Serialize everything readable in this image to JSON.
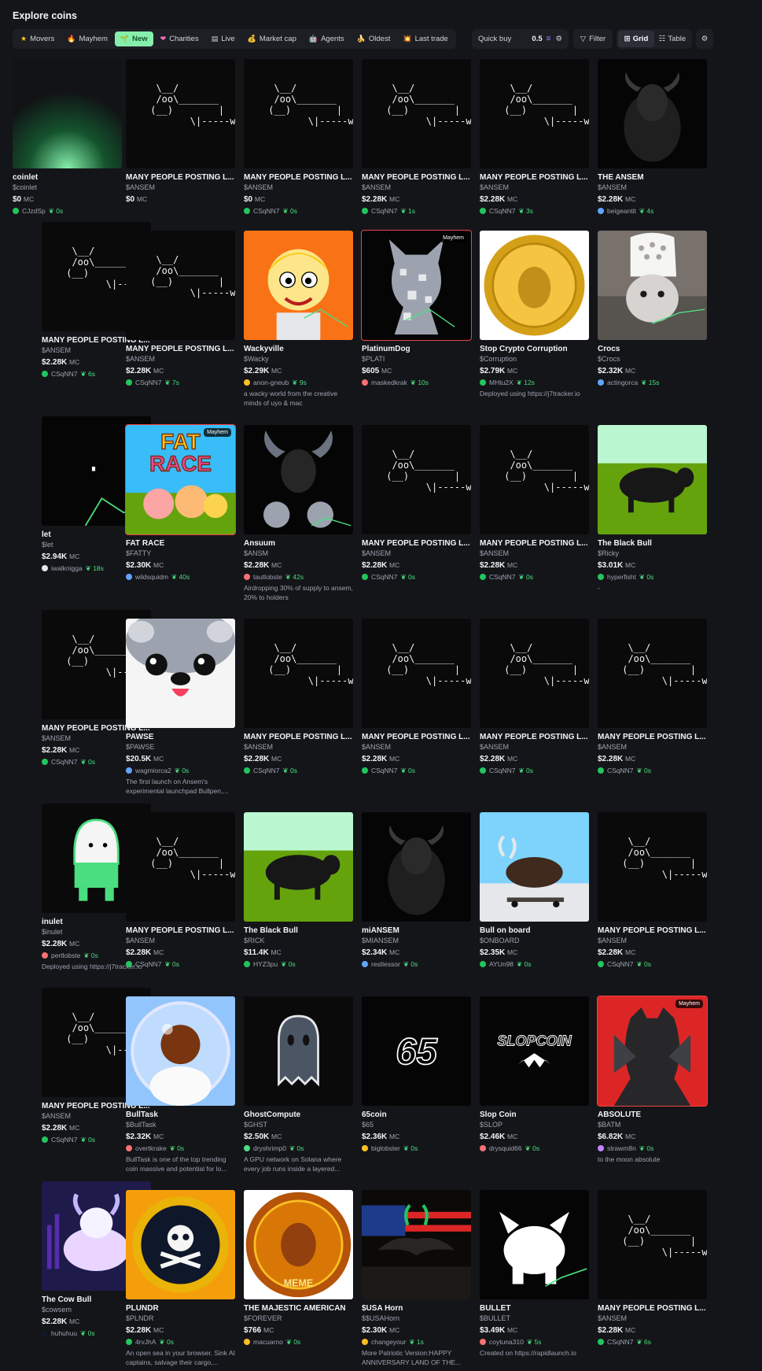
{
  "page_title": "Explore coins",
  "filters": [
    {
      "label": "Movers",
      "icon": "star-icon",
      "glyph": "★",
      "color": "#facc15"
    },
    {
      "label": "Mayhem",
      "icon": "fire-icon",
      "glyph": "🔥",
      "color": "#f97316"
    },
    {
      "label": "New",
      "icon": "sprout-icon",
      "glyph": "🌱",
      "color": "#14532d",
      "active": true
    },
    {
      "label": "Charities",
      "icon": "heart-icon",
      "glyph": "❤",
      "color": "#f472b6"
    },
    {
      "label": "Live",
      "icon": "film-icon",
      "glyph": "▤",
      "color": "#d1d5db"
    },
    {
      "label": "Market cap",
      "icon": "money-bag-icon",
      "glyph": "💰",
      "color": "#facc15"
    },
    {
      "label": "Agents",
      "icon": "robot-icon",
      "glyph": "🤖",
      "color": "#d1d5db"
    },
    {
      "label": "Oldest",
      "icon": "banana-icon",
      "glyph": "🍌",
      "color": "#facc15"
    },
    {
      "label": "Last trade",
      "icon": "sparkle-icon",
      "glyph": "💥",
      "color": "#f97316"
    }
  ],
  "quick_buy": {
    "label": "Quick buy",
    "value": "0.5"
  },
  "filter_label": "Filter",
  "view": {
    "grid": "Grid",
    "table": "Table"
  },
  "mc_unit": "MC",
  "cards": [
    {
      "name": "coinlet",
      "ticker": "$coinlet",
      "mc": "$0",
      "user": "CJzdSp",
      "age": "0s",
      "img": "glow"
    },
    {
      "name": "MANY PEOPLE POSTING L...",
      "ticker": "$ANSEM",
      "mc": "$0",
      "user": "",
      "age": "",
      "img": "ascii"
    },
    {
      "name": "MANY PEOPLE POSTING L...",
      "ticker": "$ANSEM",
      "mc": "$0",
      "user": "CSqNN7",
      "age": "0s",
      "img": "ascii"
    },
    {
      "name": "MANY PEOPLE POSTING L...",
      "ticker": "$ANSEM",
      "mc": "$2.28K",
      "user": "CSqNN7",
      "age": "1s",
      "img": "ascii"
    },
    {
      "name": "MANY PEOPLE POSTING L...",
      "ticker": "$ANSEM",
      "mc": "$2.28K",
      "user": "CSqNN7",
      "age": "3s",
      "img": "ascii"
    },
    {
      "name": "THE ANSEM",
      "ticker": "$ANSEM",
      "mc": "$2.28K",
      "user": "beigeantit",
      "age": "4s",
      "img": "bulldark",
      "av": "#60a5fa"
    },
    {
      "name": "MANY PEOPLE POSTING L...",
      "ticker": "$ANSEM",
      "mc": "$2.28K",
      "user": "CSqNN7",
      "age": "6s",
      "img": "ascii"
    },
    {
      "name": "MANY PEOPLE POSTING L...",
      "ticker": "$ANSEM",
      "mc": "$2.28K",
      "user": "CSqNN7",
      "age": "7s",
      "img": "ascii"
    },
    {
      "name": "Wackyville",
      "ticker": "$Wacky",
      "mc": "$2.29K",
      "user": "anon-gneub",
      "age": "9s",
      "img": "cartoon",
      "av": "#fbbf24",
      "desc": "a wacky world from the creative minds of uyo & mac"
    },
    {
      "name": "PlatinumDog",
      "ticker": "$PLATI",
      "mc": "$605",
      "user": "maskedkrak",
      "age": "10s",
      "img": "dog",
      "badge": "Mayhem",
      "border": "red",
      "av": "#f87171"
    },
    {
      "name": "Stop Crypto Corruption",
      "ticker": "$Corruption",
      "mc": "$2.79K",
      "user": "MHtu2X",
      "age": "12s",
      "img": "coin",
      "desc": "Deployed using https://j7tracker.io"
    },
    {
      "name": "Crocs",
      "ticker": "$Crocs",
      "mc": "$2.32K",
      "user": "actingorca",
      "age": "15s",
      "img": "cat",
      "av": "#60a5fa"
    },
    {
      "name": "let",
      "ticker": "$let",
      "mc": "$2.94K",
      "user": "iwalknigga",
      "age": "18s",
      "img": "dot",
      "av": "#e5e7eb"
    },
    {
      "name": "FAT RACE",
      "ticker": "$FATTY",
      "mc": "$2.30K",
      "user": "wildsquidm",
      "age": "40s",
      "img": "fatrace",
      "badge": "Mayhem",
      "border": "red",
      "av": "#60a5fa"
    },
    {
      "name": "Ansuum",
      "ticker": "$ANSM",
      "mc": "$2.28K",
      "user": "tautlobste",
      "age": "42s",
      "img": "ansuum",
      "av": "#f87171",
      "desc": "Airdropping 30% of supply to ansem, 20% to holders"
    },
    {
      "name": "MANY PEOPLE POSTING L...",
      "ticker": "$ANSEM",
      "mc": "$2.28K",
      "user": "CSqNN7",
      "age": "0s",
      "img": "ascii"
    },
    {
      "name": "MANY PEOPLE POSTING L...",
      "ticker": "$ANSEM",
      "mc": "$2.28K",
      "user": "CSqNN7",
      "age": "0s",
      "img": "ascii"
    },
    {
      "name": "The Black Bull",
      "ticker": "$Ricky",
      "mc": "$3.01K",
      "user": "hyperfisht",
      "age": "0s",
      "img": "bullfield",
      "desc": "-"
    },
    {
      "name": "MANY PEOPLE POSTING L...",
      "ticker": "$ANSEM",
      "mc": "$2.28K",
      "user": "CSqNN7",
      "age": "0s",
      "img": "ascii"
    },
    {
      "name": "PAWSE",
      "ticker": "$PAWSE",
      "mc": "$20.5K",
      "user": "wagmiorca2",
      "age": "0s",
      "img": "pawse",
      "av": "#60a5fa",
      "desc": "The first launch on Ansem's experimental launchpad Bullpen,..."
    },
    {
      "name": "MANY PEOPLE POSTING L...",
      "ticker": "$ANSEM",
      "mc": "$2.28K",
      "user": "CSqNN7",
      "age": "0s",
      "img": "ascii"
    },
    {
      "name": "MANY PEOPLE POSTING L...",
      "ticker": "$ANSEM",
      "mc": "$2.28K",
      "user": "CSqNN7",
      "age": "0s",
      "img": "ascii"
    },
    {
      "name": "MANY PEOPLE POSTING L...",
      "ticker": "$ANSEM",
      "mc": "$2.28K",
      "user": "CSqNN7",
      "age": "0s",
      "img": "ascii"
    },
    {
      "name": "MANY PEOPLE POSTING L...",
      "ticker": "$ANSEM",
      "mc": "$2.28K",
      "user": "CSqNN7",
      "age": "0s",
      "img": "ascii"
    },
    {
      "name": "inulet",
      "ticker": "$inulet",
      "mc": "$2.28K",
      "user": "pertlobste",
      "age": "0s",
      "img": "ghostgreen",
      "av": "#f87171",
      "desc": "Deployed using https://j7tracker.io"
    },
    {
      "name": "MANY PEOPLE POSTING L...",
      "ticker": "$ANSEM",
      "mc": "$2.28K",
      "user": "CSqNN7",
      "age": "0s",
      "img": "ascii"
    },
    {
      "name": "The Black Bull",
      "ticker": "$RICK",
      "mc": "$11.4K",
      "user": "HYZ3pu",
      "age": "0s",
      "img": "bullfield"
    },
    {
      "name": "miANSEM",
      "ticker": "$MIANSEM",
      "mc": "$2.34K",
      "user": "restlessor",
      "age": "0s",
      "img": "bulldark",
      "av": "#60a5fa"
    },
    {
      "name": "Bull on board",
      "ticker": "$ONBOARD",
      "mc": "$2.35K",
      "user": "AYUn98",
      "age": "0s",
      "img": "skate"
    },
    {
      "name": "MANY PEOPLE POSTING L...",
      "ticker": "$ANSEM",
      "mc": "$2.28K",
      "user": "CSqNN7",
      "age": "0s",
      "img": "ascii"
    },
    {
      "name": "MANY PEOPLE POSTING L...",
      "ticker": "$ANSEM",
      "mc": "$2.28K",
      "user": "CSqNN7",
      "age": "0s",
      "img": "ascii"
    },
    {
      "name": "BullTask",
      "ticker": "$BullTask",
      "mc": "$2.32K",
      "user": "overtkrake",
      "age": "0s",
      "img": "bubble",
      "av": "#f87171",
      "desc": "BullTask is one of the top trending coin massive and potential for lo..."
    },
    {
      "name": "GhostCompute",
      "ticker": "$GHST",
      "mc": "$2.50K",
      "user": "dryshrimp0",
      "age": "0s",
      "img": "ghost",
      "av": "#4ade80",
      "desc": "A GPU network on Solana where every job runs inside a layered..."
    },
    {
      "name": "65coin",
      "ticker": "$65",
      "mc": "$2.36K",
      "user": "biglobster",
      "age": "0s",
      "img": "65",
      "av": "#fbbf24"
    },
    {
      "name": "Slop Coin",
      "ticker": "$SLOP",
      "mc": "$2.46K",
      "user": "drysquid66",
      "age": "0s",
      "img": "slop",
      "av": "#f87171"
    },
    {
      "name": "ABSOLUTE",
      "ticker": "$BATM",
      "mc": "$6.82K",
      "user": "strawm8n",
      "age": "0s",
      "img": "absolute",
      "badge": "Mayhem",
      "border": "red",
      "av": "#c084fc",
      "desc": "to the moon absolute"
    },
    {
      "name": "The Cow Bull",
      "ticker": "$cowsem",
      "mc": "$2.28K",
      "user": "huhuhuu",
      "age": "0s",
      "img": "cowbull",
      "av": "#111827"
    },
    {
      "name": "PLUNDR",
      "ticker": "$PLNDR",
      "mc": "$2.28K",
      "user": "4rvJhA",
      "age": "0s",
      "img": "plundr",
      "desc": "An open sea in your browser. Sink AI captains, salvage their cargo,..."
    },
    {
      "name": "THE MAJESTIC AMERICAN",
      "ticker": "$FOREVER",
      "mc": "$766",
      "user": "macuarno",
      "age": "0s",
      "img": "meme",
      "av": "#fbbf24"
    },
    {
      "name": "$USA Horn",
      "ticker": "$$USAHorn",
      "mc": "$2.30K",
      "user": "changeyour",
      "age": "1s",
      "img": "usa",
      "av": "#fbbf24",
      "desc": "More Patriotic Version:HAPPY ANNIVERSARY LAND OF THE..."
    },
    {
      "name": "BULLET",
      "ticker": "$BULLET",
      "mc": "$3.49K",
      "user": "coytuna310",
      "age": "5s",
      "img": "bullet",
      "av": "#f87171",
      "desc": "Created on https://rapidlaunch.io"
    },
    {
      "name": "MANY PEOPLE POSTING L...",
      "ticker": "$ANSEM",
      "mc": "$2.28K",
      "user": "CSqNN7",
      "age": "6s",
      "img": "ascii"
    }
  ]
}
